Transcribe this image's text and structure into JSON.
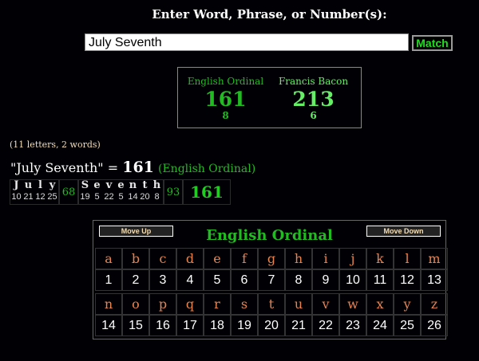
{
  "prompt": "Enter Word, Phrase, or Number(s):",
  "search": {
    "value": "July Seventh"
  },
  "match_button": "Match",
  "scores": [
    {
      "name": "English Ordinal",
      "value": "161",
      "sub": "8",
      "color": "#22bb22"
    },
    {
      "name": "Francis Bacon",
      "value": "213",
      "sub": "6",
      "color": "#66ee66"
    }
  ],
  "letter_count": "(11 letters, 2 words)",
  "result": {
    "phrase": "\"July Seventh\" = ",
    "value": "161",
    "cipher": "(English Ordinal)"
  },
  "breakdown": {
    "words": [
      {
        "letters": [
          "J",
          "u",
          "l",
          "y"
        ],
        "values": [
          "10",
          "21",
          "12",
          "25"
        ],
        "sum": "68"
      },
      {
        "letters": [
          "S",
          "e",
          "v",
          "e",
          "n",
          "t",
          "h"
        ],
        "values": [
          "19",
          "5",
          "22",
          "5",
          "14",
          "20",
          "8"
        ],
        "sum": "93"
      }
    ],
    "total": "161"
  },
  "chart": {
    "title": "English Ordinal",
    "move_up": "Move Up",
    "move_down": "Move Down",
    "row1_letters": [
      "a",
      "b",
      "c",
      "d",
      "e",
      "f",
      "g",
      "h",
      "i",
      "j",
      "k",
      "l",
      "m"
    ],
    "row1_values": [
      "1",
      "2",
      "3",
      "4",
      "5",
      "6",
      "7",
      "8",
      "9",
      "10",
      "11",
      "12",
      "13"
    ],
    "row2_letters": [
      "n",
      "o",
      "p",
      "q",
      "r",
      "s",
      "t",
      "u",
      "v",
      "w",
      "x",
      "y",
      "z"
    ],
    "row2_values": [
      "14",
      "15",
      "16",
      "17",
      "18",
      "19",
      "20",
      "21",
      "22",
      "23",
      "24",
      "25",
      "26"
    ]
  }
}
